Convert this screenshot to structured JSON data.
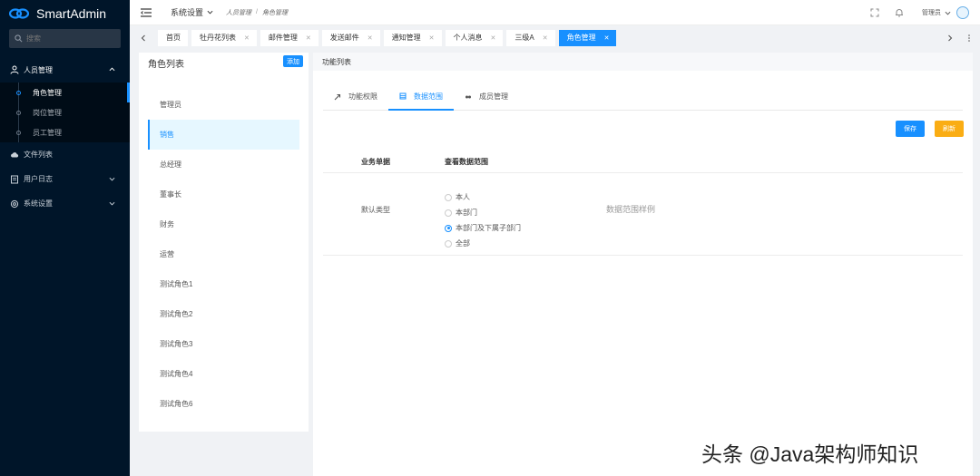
{
  "app": {
    "name": "SmartAdmin"
  },
  "sidebar": {
    "search_placeholder": "搜索",
    "groups": [
      {
        "label": "人员管理",
        "items": [
          {
            "label": "角色管理",
            "active": true
          },
          {
            "label": "岗位管理"
          },
          {
            "label": "员工管理"
          }
        ]
      },
      {
        "label": "文件列表"
      },
      {
        "label": "用户日志"
      },
      {
        "label": "系统设置"
      }
    ]
  },
  "header": {
    "menu_label": "系统设置",
    "breadcrumb": [
      "人员管理",
      "角色管理"
    ],
    "user": "管理员"
  },
  "tabs": [
    {
      "label": "首页",
      "closable": false
    },
    {
      "label": "牡丹花列表",
      "closable": true
    },
    {
      "label": "邮件管理",
      "closable": true
    },
    {
      "label": "发送邮件",
      "closable": true
    },
    {
      "label": "通知管理",
      "closable": true
    },
    {
      "label": "个人消息",
      "closable": true
    },
    {
      "label": "三级A",
      "closable": true
    },
    {
      "label": "角色管理",
      "closable": true,
      "active": true
    }
  ],
  "role_panel": {
    "title": "角色列表",
    "add_label": "添加",
    "roles": [
      "管理员",
      "销售",
      "总经理",
      "董事长",
      "财务",
      "运营",
      "测试角色1",
      "测试角色2",
      "测试角色3",
      "测试角色4",
      "测试角色6"
    ],
    "active_role": "销售"
  },
  "func_panel": {
    "title": "功能列表",
    "tabs": [
      {
        "label": "功能权限",
        "icon": "key-icon"
      },
      {
        "label": "数据范围",
        "icon": "table-icon",
        "active": true
      },
      {
        "label": "成员管理",
        "icon": "team-icon"
      }
    ],
    "save_label": "保存",
    "refresh_label": "刷新",
    "table": {
      "col_type": "业务单据",
      "col_range": "查看数据范围",
      "row_type": "默认类型",
      "options": [
        "本人",
        "本部门",
        "本部门及下属子部门",
        "全部"
      ],
      "selected": "本部门及下属子部门",
      "sample": "数据范围样例"
    }
  },
  "watermark": "头条 @Java架构师知识",
  "colors": {
    "primary": "#1890ff",
    "sidebar": "#001529",
    "warning": "#faad14"
  }
}
